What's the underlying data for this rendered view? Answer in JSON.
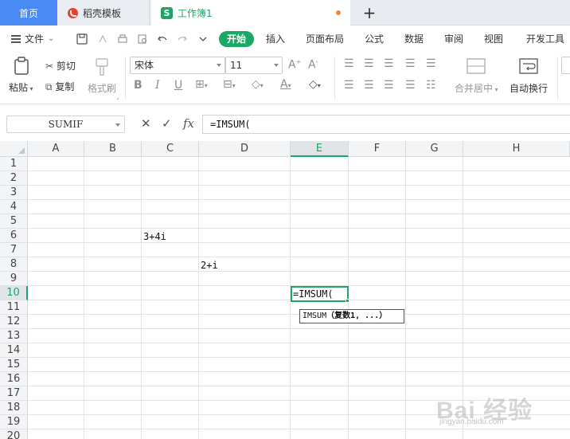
{
  "tabs": {
    "home": "首页",
    "template": "稻壳模板",
    "workbook": "工作簿1",
    "workbook_icon": "S",
    "new_tab": "+"
  },
  "menu": {
    "file": "文件",
    "items": [
      "开始",
      "插入",
      "页面布局",
      "公式",
      "数据",
      "审阅",
      "视图",
      "开发工具"
    ],
    "active": "开始"
  },
  "ribbon": {
    "paste": "粘贴",
    "cut": "剪切",
    "copy": "复制",
    "format_painter": "格式刷",
    "font_name": "宋体",
    "font_size": "11",
    "merge_center": "合并居中",
    "wrap_text": "自动换行"
  },
  "formula_bar": {
    "name_box": "SUMIF",
    "fx": "fx",
    "formula": "=IMSUM("
  },
  "grid": {
    "columns": [
      "A",
      "B",
      "C",
      "D",
      "E",
      "F",
      "G",
      "H"
    ],
    "active_column": "E",
    "rows": [
      "1",
      "2",
      "3",
      "4",
      "5",
      "6",
      "7",
      "8",
      "9",
      "10",
      "11",
      "12",
      "13",
      "14",
      "15",
      "16",
      "17",
      "18",
      "19",
      "20"
    ],
    "active_row": "10",
    "cells": {
      "C6": "3+4i",
      "D8": "2+i",
      "E10": "=IMSUM("
    },
    "tooltip": {
      "func": "IMSUM",
      "arg": "（复数1,  ...）"
    }
  },
  "colors": {
    "accent": "#1aa864",
    "home_tab": "#4a8af4"
  },
  "watermark": {
    "main": "Bai 经验",
    "sub": "jingyan.baidu.com"
  }
}
